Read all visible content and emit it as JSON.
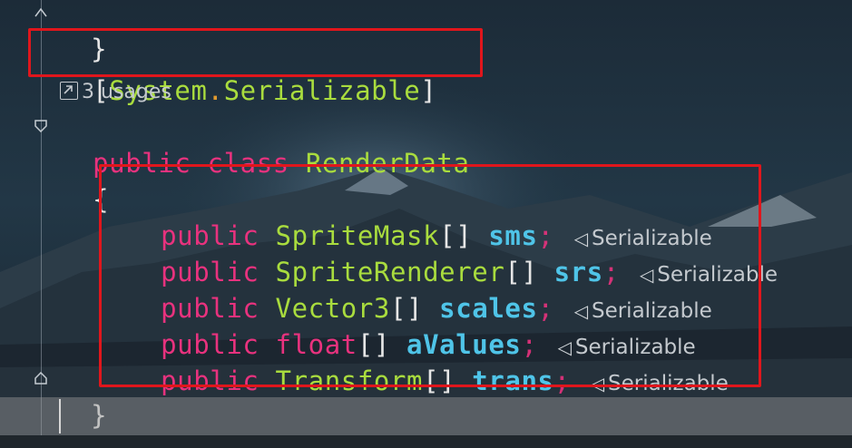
{
  "editor": {
    "line_close_brace_top": "}",
    "attribute": {
      "open_bracket": "[",
      "namespace": "System",
      "dot": ".",
      "name": "Serializable",
      "close_bracket": "]"
    },
    "usages_label": "3 usages",
    "class_decl": {
      "keyword_public": "public",
      "keyword_class": "class",
      "class_name": "RenderData"
    },
    "open_brace": "{",
    "close_brace": "}",
    "fields": [
      {
        "modifier": "public",
        "type": "SpriteMask",
        "brackets": "[]",
        "name": "sms",
        "semicolon": ";",
        "hint": "Serializable"
      },
      {
        "modifier": "public",
        "type": "SpriteRenderer",
        "brackets": "[]",
        "name": "srs",
        "semicolon": ";",
        "hint": "Serializable"
      },
      {
        "modifier": "public",
        "type": "Vector3",
        "brackets": "[]",
        "name": "scales",
        "semicolon": ";",
        "hint": "Serializable"
      },
      {
        "modifier": "public",
        "type": "float",
        "brackets": "[]",
        "name": "aValues",
        "semicolon": ";",
        "hint": "Serializable"
      },
      {
        "modifier": "public",
        "type": "Transform",
        "brackets": "[]",
        "name": "trans",
        "semicolon": ";",
        "hint": "Serializable"
      }
    ]
  },
  "colors": {
    "keyword": "#e8327e",
    "type": "#a9dc3e",
    "field": "#4fc4e8",
    "punctuation": "#e6e6e6",
    "highlight_box": "#e0161c"
  },
  "icons": {
    "usages": "external-link-icon",
    "unity_hint": "unity-icon"
  }
}
